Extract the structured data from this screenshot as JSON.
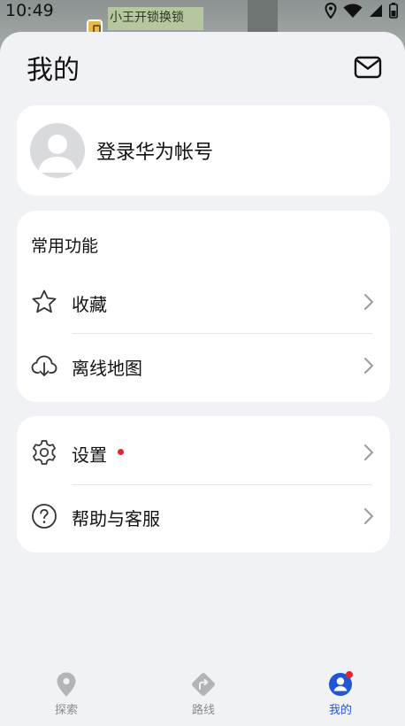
{
  "status_bar": {
    "time": "10:49"
  },
  "map": {
    "poi_label": "小王开锁换锁"
  },
  "header": {
    "title": "我的"
  },
  "account": {
    "login_text": "登录华为帐号"
  },
  "features": {
    "section_title": "常用功能",
    "items": [
      {
        "label": "收藏",
        "icon": "star-icon"
      },
      {
        "label": "离线地图",
        "icon": "cloud-download-icon"
      }
    ]
  },
  "settings_card": {
    "items": [
      {
        "label": "设置",
        "icon": "gear-icon",
        "badge": true
      },
      {
        "label": "帮助与客服",
        "icon": "help-icon"
      }
    ]
  },
  "bottom_nav": {
    "items": [
      {
        "label": "探索",
        "icon": "location-pin-icon",
        "active": false
      },
      {
        "label": "路线",
        "icon": "route-icon",
        "active": false
      },
      {
        "label": "我的",
        "icon": "profile-icon",
        "active": true
      }
    ]
  },
  "colors": {
    "accent": "#1f56d8",
    "badge": "#e5232b",
    "background": "#f1f2f5"
  }
}
